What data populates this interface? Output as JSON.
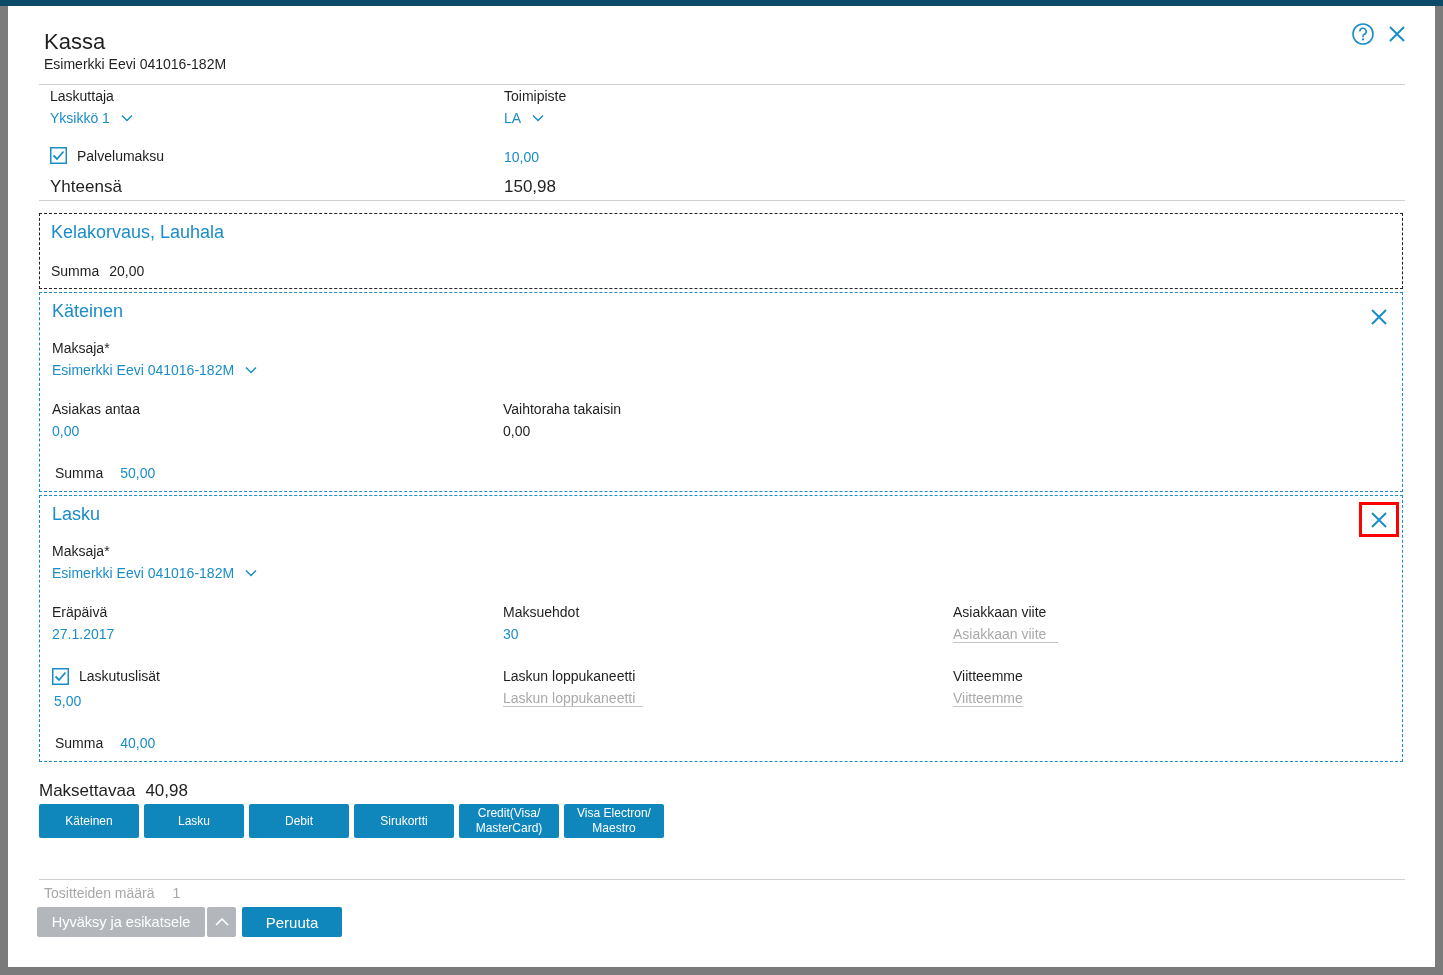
{
  "dialog": {
    "title": "Kassa",
    "subtitle": "Esimerkki Eevi 041016-182M"
  },
  "billing": {
    "fields": [
      {
        "kind": "dropdown",
        "label": "Laskuttaja",
        "value": "Yksikkö 1"
      },
      {
        "kind": "dropdown",
        "label": "Toimipiste",
        "value": "LA"
      }
    ],
    "service_fee": {
      "label": "Palvelumaksu",
      "checked": true,
      "value": "10,00"
    },
    "total": {
      "label": "Yhteensä",
      "value": "150,98"
    }
  },
  "payments": [
    {
      "kind": "fixed",
      "title": "Kelakorvaus, Lauhala",
      "sum": {
        "kind": "text",
        "label": "Summa",
        "value": "20,00"
      }
    },
    {
      "kind": "method",
      "title": "Käteinen",
      "remove": {
        "highlighted": false
      },
      "payer": {
        "label": "Maksaja*",
        "value": "Esimerkki Eevi 041016-182M"
      },
      "fields": [
        {
          "kind": "input",
          "label": "Asiakas antaa",
          "value": "0,00"
        },
        {
          "kind": "text",
          "label": "Vaihtoraha takaisin",
          "value": "0,00"
        }
      ],
      "sum": {
        "kind": "input",
        "label": "Summa",
        "value": "50,00"
      }
    },
    {
      "kind": "method",
      "title": "Lasku",
      "remove": {
        "highlighted": true
      },
      "payer": {
        "label": "Maksaja*",
        "value": "Esimerkki Eevi 041016-182M"
      },
      "fields": [
        {
          "kind": "input",
          "label": "Eräpäivä",
          "value": "27.1.2017"
        },
        {
          "kind": "input",
          "label": "Maksuehdot",
          "value": "30"
        },
        {
          "kind": "input",
          "label": "Asiakkaan viite",
          "placeholder": "Asiakkaan viite"
        },
        {
          "kind": "checkbox",
          "label": "Laskutuslisät",
          "checked": true,
          "value": "5,00"
        },
        {
          "kind": "input",
          "label": "Laskun loppukaneetti",
          "placeholder": "Laskun loppukaneetti"
        },
        {
          "kind": "input",
          "label": "Viitteemme",
          "placeholder": "Viitteemme"
        }
      ],
      "sum": {
        "kind": "input",
        "label": "Summa",
        "value": "40,00"
      }
    }
  ],
  "amount_due": {
    "label": "Maksettavaa",
    "value": "40,98"
  },
  "payment_methods": [
    "Käteinen",
    "Lasku",
    "Debit",
    "Sirukortti",
    "Credit(Visa/ MasterCard)",
    "Visa Electron/ Maestro"
  ],
  "footer": {
    "voucher_count": {
      "label": "Tositteiden määrä",
      "value": "1"
    },
    "buttons": [
      {
        "kind": "split",
        "label": "Hyväksy ja esikatsele",
        "disabled": true
      },
      {
        "kind": "plain",
        "label": "Peruuta",
        "disabled": false
      }
    ]
  }
}
